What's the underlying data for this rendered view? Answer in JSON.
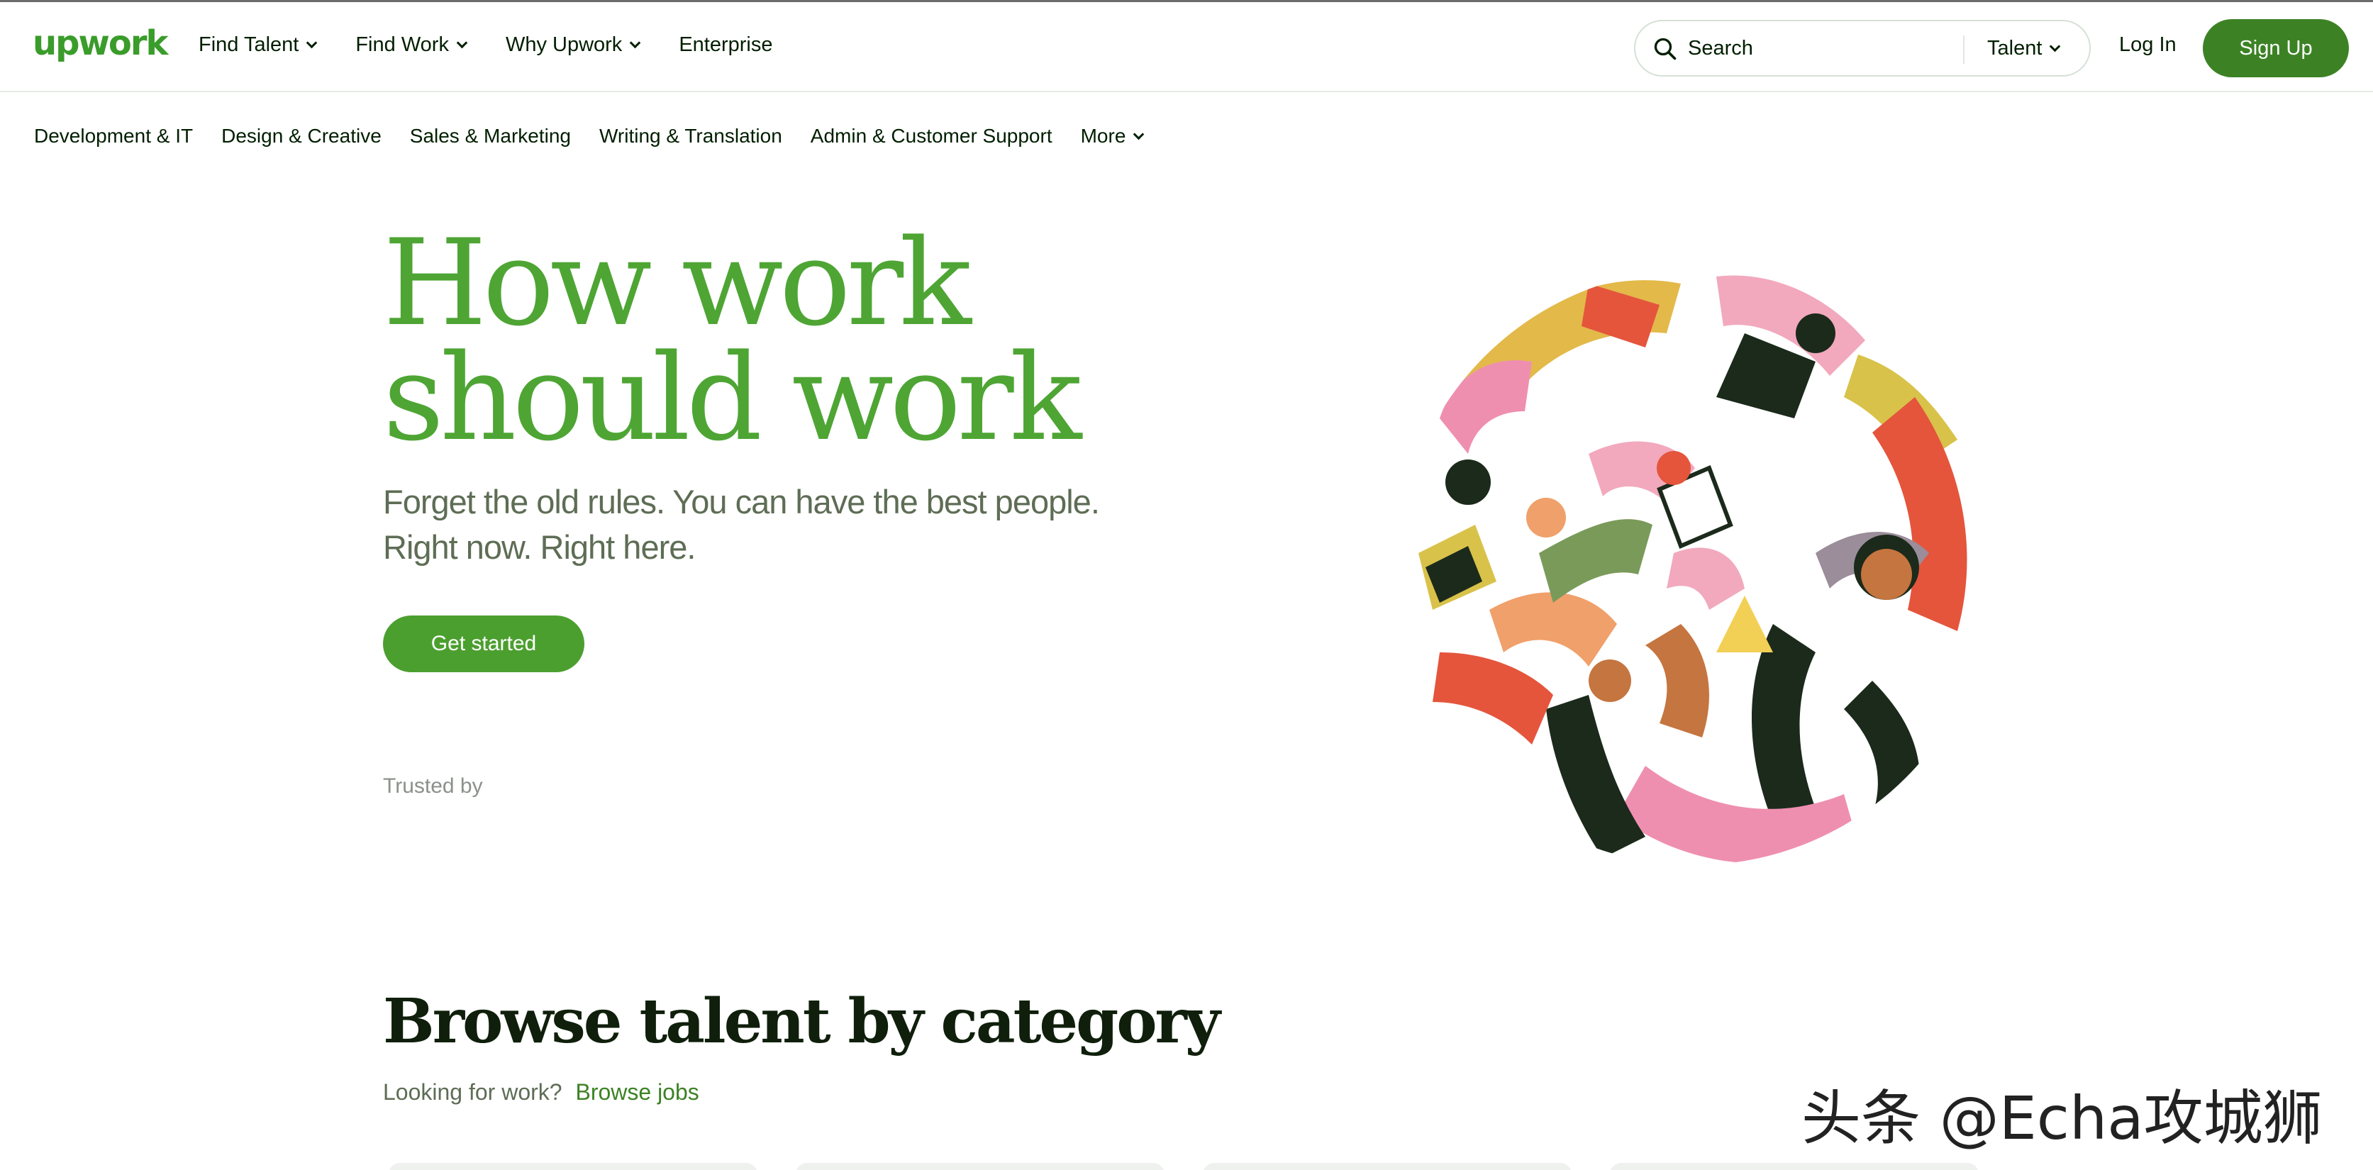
{
  "brand": {
    "name": "upwork",
    "color": "#3a9c2a"
  },
  "header": {
    "nav": [
      {
        "label": "Find Talent",
        "has_dropdown": true
      },
      {
        "label": "Find Work",
        "has_dropdown": true
      },
      {
        "label": "Why Upwork",
        "has_dropdown": true
      },
      {
        "label": "Enterprise",
        "has_dropdown": false
      }
    ],
    "search": {
      "placeholder": "Search",
      "type_label": "Talent",
      "icon": "search-icon"
    },
    "login_label": "Log In",
    "signup_label": "Sign Up"
  },
  "categories_nav": {
    "items": [
      "Development & IT",
      "Design & Creative",
      "Sales & Marketing",
      "Writing & Translation",
      "Admin & Customer Support"
    ],
    "more_label": "More"
  },
  "hero": {
    "headline_line1": "How work",
    "headline_line2": "should work",
    "subhead_line1": "Forget the old rules. You can have the best people.",
    "subhead_line2": "Right now. Right here.",
    "cta_label": "Get started",
    "trusted_label": "Trusted by"
  },
  "browse": {
    "title": "Browse talent by category",
    "prompt": "Looking for work?",
    "link": "Browse jobs"
  },
  "watermark": "头条 @Echa攻城狮",
  "colors": {
    "accent": "#3c8224",
    "headline": "#4ea534",
    "text": "#001e00"
  }
}
